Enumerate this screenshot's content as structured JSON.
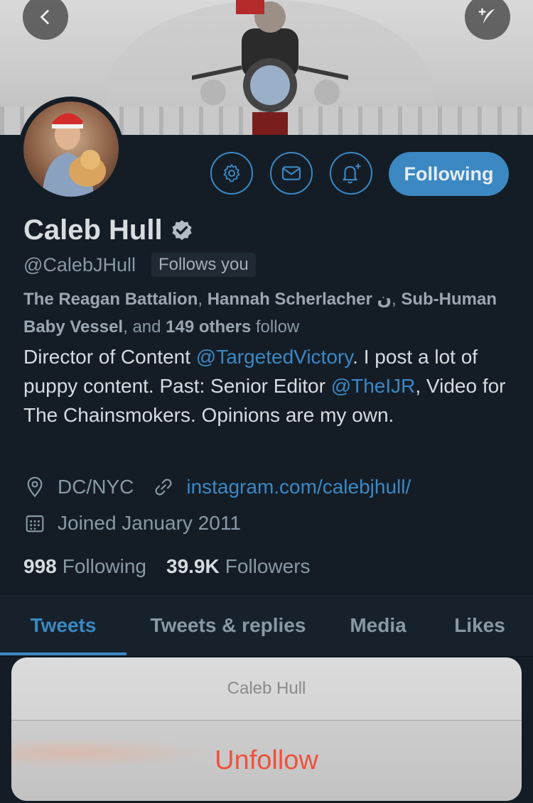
{
  "colors": {
    "background": "#141d26",
    "accent": "#3b88c3",
    "destructive": "#f2503a"
  },
  "header": {
    "back_icon": "chevron-left-icon",
    "compose_icon": "compose-tweet-icon"
  },
  "actions": {
    "settings_icon": "gear-icon",
    "message_icon": "envelope-icon",
    "notify_icon": "bell-plus-icon",
    "following_label": "Following"
  },
  "profile": {
    "name": "Caleb Hull",
    "handle": "@CalebJHull",
    "follows_you": "Follows you",
    "followed_by": {
      "name1": "The Reagan Battalion",
      "sep1": ", ",
      "name2": "Hannah Scherlacher ن",
      "sep2": ", ",
      "name3": "Sub-Human Baby Vessel",
      "mid": ", and ",
      "others": "149 others",
      "suffix": " follow"
    },
    "bio": {
      "p1": "Director of Content ",
      "link1": "@TargetedVictory",
      "p2": ". I post a lot of puppy content. Past: Senior Editor ",
      "link2": "@TheIJR",
      "p3": ", Video for The Chainsmokers. Opinions are my own."
    },
    "location": "DC/NYC",
    "website": "instagram.com/calebjhull/",
    "joined": "Joined January 2011",
    "following_count": "998",
    "following_label": "Following",
    "followers_count": "39.9K",
    "followers_label": "Followers"
  },
  "tabs": [
    {
      "label": "Tweets",
      "active": true
    },
    {
      "label": "Tweets & replies",
      "active": false
    },
    {
      "label": "Media",
      "active": false
    },
    {
      "label": "Likes",
      "active": false
    }
  ],
  "action_sheet": {
    "title": "Caleb Hull",
    "action": "Unfollow"
  }
}
